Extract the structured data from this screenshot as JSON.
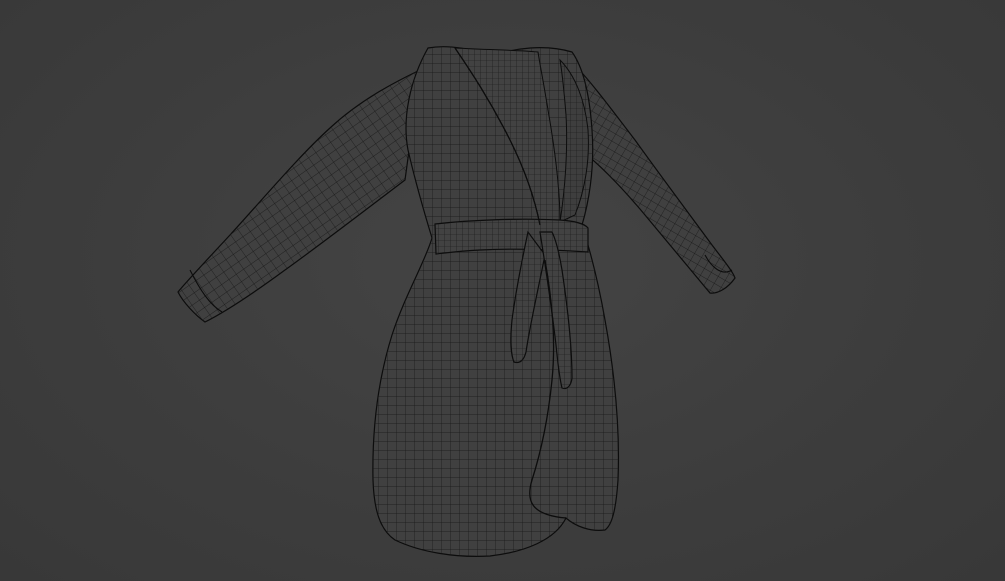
{
  "viewport": {
    "background_color": "#3d3d3d",
    "mesh_fill_color": "#404040",
    "wire_color": "#151515",
    "outline_color": "#0c0c0c"
  },
  "object": {
    "kind": "wrap-robe-mesh",
    "shading": "wireframe-overlay"
  }
}
